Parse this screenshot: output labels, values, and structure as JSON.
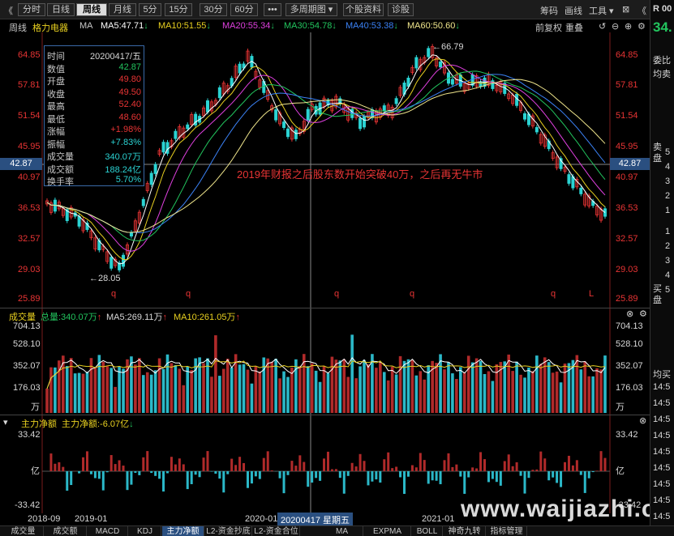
{
  "toolbar": {
    "back": "《",
    "periods": [
      "分时",
      "日线",
      "周线",
      "月线",
      "5分",
      "15分",
      "30分",
      "60分"
    ],
    "active_period": "周线",
    "more": "•••",
    "multi_period": "多周期图",
    "stock_info": "个股资料",
    "diagnose": "诊股",
    "chips": "筹码",
    "draw": "画线",
    "tools": "工具"
  },
  "infobar": {
    "period": "周线",
    "name": "格力电器",
    "ma_label": "MA",
    "ma5": "MA5:47.71",
    "ma10": "MA10:51.55",
    "ma20": "MA20:55.34",
    "ma30": "MA30:54.78",
    "ma40": "MA40:53.38",
    "ma60": "MA60:50.60",
    "adjust": "前复权",
    "overlay": "重叠"
  },
  "price_axis": {
    "ticks": [
      "64.85",
      "57.81",
      "51.54",
      "45.95",
      "40.97",
      "36.53",
      "32.57",
      "29.03",
      "25.89"
    ],
    "current": "42.87"
  },
  "annotations": {
    "high": "66.79",
    "low": "28.05",
    "note": "2019年财报之后股东数开始突破40万，之后再无牛市",
    "markers": [
      "q",
      "q",
      "q",
      "q",
      "q",
      "L"
    ]
  },
  "infobox": {
    "rows": [
      {
        "k": "时间",
        "v": "20200417/五",
        "c": "white"
      },
      {
        "k": "数值",
        "v": "42.87",
        "c": "green"
      },
      {
        "k": "开盘",
        "v": "49.80",
        "c": "red"
      },
      {
        "k": "收盘",
        "v": "49.50",
        "c": "red"
      },
      {
        "k": "最高",
        "v": "52.40",
        "c": "red"
      },
      {
        "k": "最低",
        "v": "48.60",
        "c": "red"
      },
      {
        "k": "涨幅",
        "v": "+1.98%",
        "c": "red"
      },
      {
        "k": "振幅",
        "v": "+7.83%",
        "c": "cyan"
      },
      {
        "k": "成交量",
        "v": "340.07万",
        "c": "cyan"
      },
      {
        "k": "成交额",
        "v": "188.24亿",
        "c": "cyan"
      },
      {
        "k": "换手率",
        "v": "5.70%",
        "c": "cyan"
      }
    ]
  },
  "volume": {
    "title": "成交量",
    "total": "总量:340.07万",
    "ma5": "MA5:269.11万",
    "ma10": "MA10:261.05万",
    "ticks": [
      "704.13",
      "528.10",
      "352.07",
      "176.03"
    ],
    "unit": "万"
  },
  "netflow": {
    "title": "主力净额",
    "value": "主力净额:-6.07亿",
    "ticks_top": "33.42",
    "unit": "亿",
    "ticks_bottom": "-33.42"
  },
  "time_axis": {
    "labels": [
      "2018-09",
      "2019-01",
      "2020-01",
      "2021-01"
    ],
    "cursor": "20200417 星期五"
  },
  "bottom_tabs": [
    "成交量",
    "成交额",
    "MACD",
    "KDJ",
    "主力净额",
    "L2-资金抄底",
    "L2-资金合位",
    "MA",
    "EXPMA",
    "BOLL",
    "神奇九转",
    "指标管理"
  ],
  "active_bottom_tab": "主力净额",
  "watermark": "www.waijiazhi.com",
  "right_panel": {
    "code": "R 00",
    "price": "34.",
    "wei": "委比",
    "junmai": "均卖",
    "sell": "卖盘",
    "buy": "买盘",
    "junmai2": "均买",
    "sell_nums": [
      "5",
      "4",
      "3",
      "2",
      "1"
    ],
    "buy_nums": [
      "1",
      "2",
      "3",
      "4",
      "5"
    ],
    "times": [
      "14:5",
      "14:5",
      "14:5",
      "14:5",
      "14:5",
      "14:5",
      "14:5",
      "14:5",
      "14:5"
    ]
  },
  "colors": {
    "up": "#e83434",
    "down": "#2bd3d3",
    "ma5": "#ffffff",
    "ma10": "#e8d020",
    "ma20": "#e040e0",
    "ma30": "#22c55e",
    "ma40": "#3b82f6",
    "ma60": "#f0e68c"
  }
}
